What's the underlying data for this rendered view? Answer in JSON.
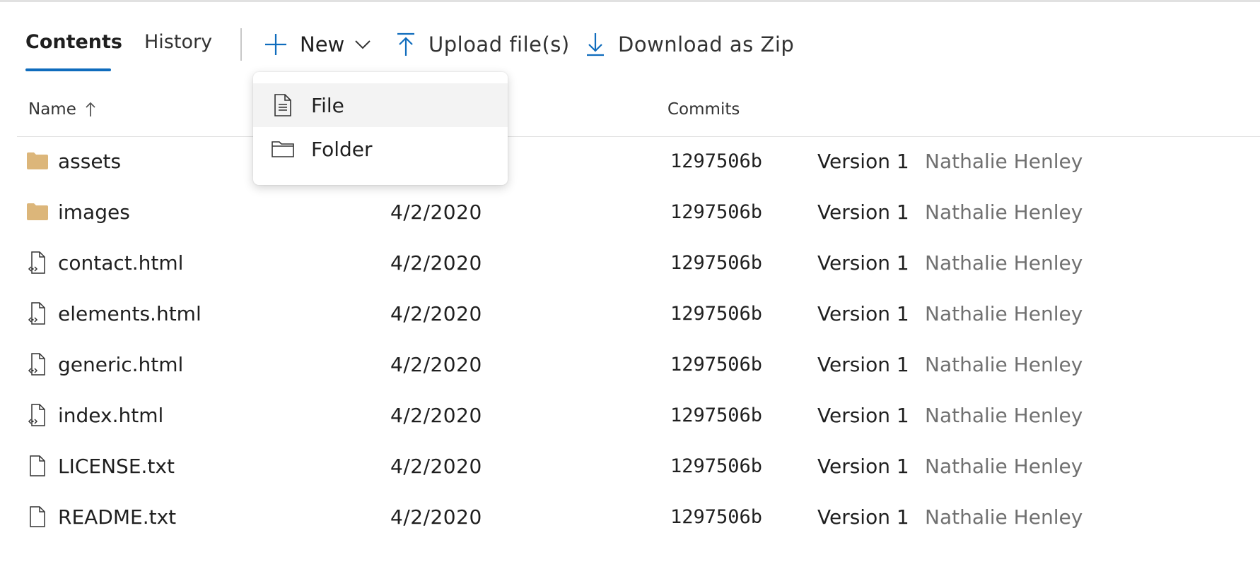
{
  "tabs": [
    {
      "label": "Contents",
      "active": true
    },
    {
      "label": "History",
      "active": false
    }
  ],
  "toolbar": {
    "new_label": "New",
    "upload_label": "Upload file(s)",
    "download_label": "Download as Zip"
  },
  "dropdown": {
    "items": [
      {
        "label": "File",
        "icon": "file-text-icon"
      },
      {
        "label": "Folder",
        "icon": "folder-outline-icon"
      }
    ]
  },
  "table": {
    "headers": {
      "name": "Name",
      "commits": "Commits"
    },
    "rows": [
      {
        "name": "assets",
        "type": "folder",
        "date": "",
        "commit": "1297506b",
        "message": "Version 1",
        "author": "Nathalie Henley"
      },
      {
        "name": "images",
        "type": "folder",
        "date": "4/2/2020",
        "commit": "1297506b",
        "message": "Version 1",
        "author": "Nathalie Henley"
      },
      {
        "name": "contact.html",
        "type": "code",
        "date": "4/2/2020",
        "commit": "1297506b",
        "message": "Version 1",
        "author": "Nathalie Henley"
      },
      {
        "name": "elements.html",
        "type": "code",
        "date": "4/2/2020",
        "commit": "1297506b",
        "message": "Version 1",
        "author": "Nathalie Henley"
      },
      {
        "name": "generic.html",
        "type": "code",
        "date": "4/2/2020",
        "commit": "1297506b",
        "message": "Version 1",
        "author": "Nathalie Henley"
      },
      {
        "name": "index.html",
        "type": "code",
        "date": "4/2/2020",
        "commit": "1297506b",
        "message": "Version 1",
        "author": "Nathalie Henley"
      },
      {
        "name": "LICENSE.txt",
        "type": "file",
        "date": "4/2/2020",
        "commit": "1297506b",
        "message": "Version 1",
        "author": "Nathalie Henley"
      },
      {
        "name": "README.txt",
        "type": "file",
        "date": "4/2/2020",
        "commit": "1297506b",
        "message": "Version 1",
        "author": "Nathalie Henley"
      }
    ]
  },
  "colors": {
    "accent": "#0f6cbd",
    "folder": "#dcb67a",
    "muted_text": "#707070"
  }
}
